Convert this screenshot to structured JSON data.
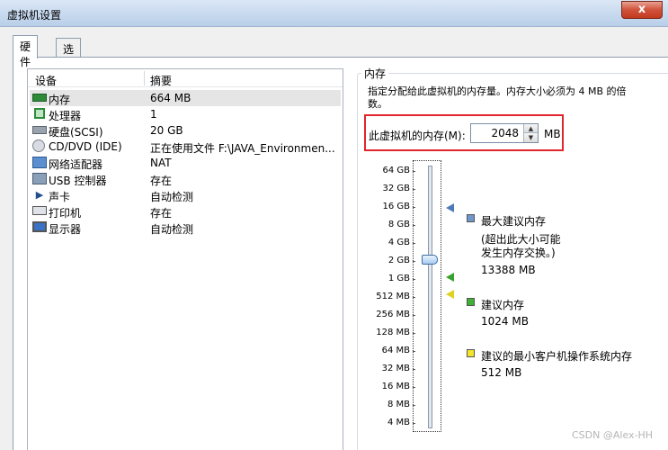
{
  "window": {
    "title": "虚拟机设置",
    "close_label": "x"
  },
  "tabs": [
    {
      "label": "硬件"
    },
    {
      "label": "选项"
    }
  ],
  "device_list": {
    "col_device": "设备",
    "col_summary": "摘要",
    "rows": [
      {
        "icon": "memory-icon",
        "name": "内存",
        "summary": "664 MB"
      },
      {
        "icon": "processor-icon",
        "name": "处理器",
        "summary": "1"
      },
      {
        "icon": "harddisk-icon",
        "name": "硬盘(SCSI)",
        "summary": "20 GB"
      },
      {
        "icon": "cd-dvd-icon",
        "name": "CD/DVD (IDE)",
        "summary": "正在使用文件 F:\\JAVA_Environmen..."
      },
      {
        "icon": "network-adapter-icon",
        "name": "网络适配器",
        "summary": "NAT"
      },
      {
        "icon": "usb-controller-icon",
        "name": "USB 控制器",
        "summary": "存在"
      },
      {
        "icon": "sound-card-icon",
        "name": "声卡",
        "summary": "自动检测"
      },
      {
        "icon": "printer-icon",
        "name": "打印机",
        "summary": "存在"
      },
      {
        "icon": "display-icon",
        "name": "显示器",
        "summary": "自动检测"
      }
    ]
  },
  "memory": {
    "group_label": "内存",
    "description": "指定分配给此虚拟机的内存量。内存大小必须为 4 MB 的倍数。",
    "field_label": "此虚拟机的内存(M):",
    "value": "2048",
    "unit": "MB",
    "scale_labels": [
      "64 GB",
      "32 GB",
      "16 GB",
      "8 GB",
      "4 GB",
      "2 GB",
      "1 GB",
      "512 MB",
      "256 MB",
      "128 MB",
      "64 MB",
      "32 MB",
      "16 MB",
      "8 MB",
      "4 MB"
    ],
    "legend": {
      "max_title": "最大建议内存",
      "max_note_1": "(超出此大小可能",
      "max_note_2": "发生内存交换。)",
      "max_value": "13388 MB",
      "rec_title": "建议内存",
      "rec_value": "1024 MB",
      "min_title": "建议的最小客户机操作系统内存",
      "min_value": "512 MB"
    }
  },
  "colors": {
    "max": "#4f7ab8",
    "recommended": "#36a12b",
    "minimum": "#e0d21e",
    "highlight_box": "#e0262c"
  },
  "watermark": "CSDN @Alex-HH"
}
